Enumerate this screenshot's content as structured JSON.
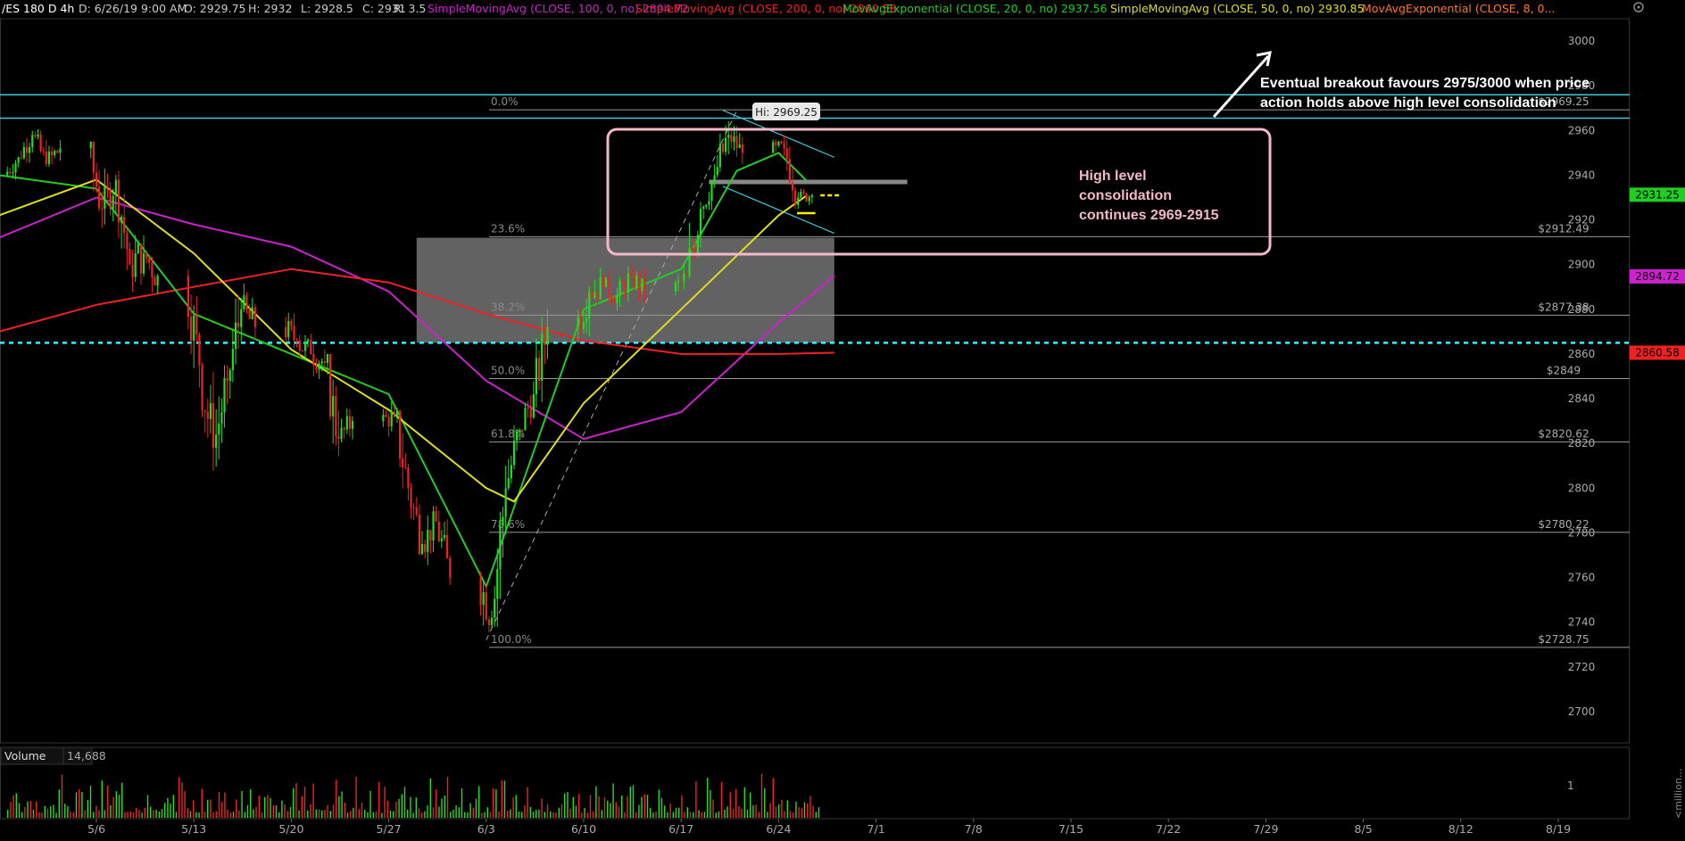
{
  "header": {
    "symbol": "/ES 180 D 4h",
    "bar_date": "D: 6/26/19 9:00 AM",
    "open": "O: 2929.75",
    "high": "H: 2932",
    "low": "L: 2928.5",
    "close": "C: 2931",
    "range": "R: 3.5",
    "studies": [
      {
        "label": "SimpleMovingAvg (CLOSE, 100, 0, no)",
        "value": "2894.72",
        "color": "#cc22cc"
      },
      {
        "label": "SimpleMovingAvg (CLOSE, 200, 0, no)",
        "value": "2860.58",
        "color": "#ee2222"
      },
      {
        "label": "MovAvgExponential (CLOSE, 20, 0, no)",
        "value": "2937.56",
        "color": "#22cc22"
      },
      {
        "label": "SimpleMovingAvg (CLOSE, 50, 0, no)",
        "value": "2930.85",
        "color": "#dddd22"
      },
      {
        "label": "MovAvgExponential (CLOSE, 8, 0...",
        "value": "",
        "color": "#ff7722"
      }
    ]
  },
  "annotations": {
    "breakout": "Eventual breakout favours 2975/3000 when price action holds above high level consolidation",
    "consolidation": "High level consolidation continues 2969-2915",
    "hi_label": "Hi: 2969.25"
  },
  "volume": {
    "label": "Volume",
    "value": "14,688",
    "axis_tick": "1",
    "axis_unit": "<million..."
  },
  "chart_data": {
    "type": "candlestick",
    "title": "/ES 180 D 4h",
    "x_ticks": [
      "5/6",
      "5/13",
      "5/20",
      "5/27",
      "6/3",
      "6/10",
      "6/17",
      "6/24",
      "7/1",
      "7/8",
      "7/15",
      "7/22",
      "7/29",
      "8/5",
      "8/12",
      "8/19"
    ],
    "y_ticks": [
      2700,
      2720,
      2740,
      2760,
      2780,
      2800,
      2820,
      2840,
      2860,
      2880,
      2900,
      2920,
      2940,
      2960,
      2980,
      3000
    ],
    "ylim": [
      2686,
      3010
    ],
    "last_price": 2931.25,
    "price_badges": [
      {
        "value": "2931.25",
        "color": "#22cc22"
      },
      {
        "value": "2894.72",
        "color": "#cc22cc"
      },
      {
        "value": "2860.58",
        "color": "#ee2222"
      }
    ],
    "fibonacci": [
      {
        "level": "0.0%",
        "price": 2969.25,
        "label": "$2969.25"
      },
      {
        "level": "23.6%",
        "price": 2912.49,
        "label": "$2912.49"
      },
      {
        "level": "38.2%",
        "price": 2877.38,
        "label": "$2877.38"
      },
      {
        "level": "50.0%",
        "price": 2849,
        "label": "$2849"
      },
      {
        "level": "61.8%",
        "price": 2820.62,
        "label": "$2820.62"
      },
      {
        "level": "78.6%",
        "price": 2780.22,
        "label": "$2780.22"
      },
      {
        "level": "100.0%",
        "price": 2728.75,
        "label": "$2728.75"
      }
    ],
    "horizontal_lines": [
      2976,
      2965.5
    ],
    "dotted_support": 2865,
    "shaded_zone": {
      "from": "5/29",
      "to": "6/28",
      "low": 2865,
      "high": 2912
    },
    "candles": [
      [
        "4/30",
        2940,
        2952,
        2935,
        2948
      ],
      [
        "5/1",
        2948,
        2962,
        2944,
        2958
      ],
      [
        "5/2",
        2958,
        2962,
        2940,
        2945
      ],
      [
        "5/3",
        2945,
        2958,
        2936,
        2952
      ],
      [
        "5/6",
        2952,
        2955,
        2915,
        2925
      ],
      [
        "5/7",
        2925,
        2948,
        2915,
        2938
      ],
      [
        "5/8",
        2938,
        2942,
        2895,
        2900
      ],
      [
        "5/9",
        2900,
        2918,
        2880,
        2905
      ],
      [
        "5/10",
        2905,
        2915,
        2880,
        2895
      ],
      [
        "5/13",
        2895,
        2898,
        2845,
        2855
      ],
      [
        "5/14",
        2855,
        2862,
        2800,
        2818
      ],
      [
        "5/15",
        2818,
        2855,
        2805,
        2848
      ],
      [
        "5/16",
        2848,
        2895,
        2840,
        2880
      ],
      [
        "5/17",
        2880,
        2892,
        2860,
        2872
      ],
      [
        "5/20",
        2872,
        2880,
        2855,
        2866
      ],
      [
        "5/21",
        2866,
        2878,
        2852,
        2860
      ],
      [
        "5/22",
        2860,
        2868,
        2845,
        2856
      ],
      [
        "5/23",
        2856,
        2860,
        2810,
        2822
      ],
      [
        "5/24",
        2822,
        2838,
        2815,
        2830
      ],
      [
        "5/27",
        2830,
        2840,
        2820,
        2832
      ],
      [
        "5/28",
        2832,
        2836,
        2790,
        2800
      ],
      [
        "5/29",
        2800,
        2808,
        2770,
        2775
      ],
      [
        "5/30",
        2775,
        2792,
        2765,
        2785
      ],
      [
        "5/31",
        2785,
        2790,
        2750,
        2760
      ],
      [
        "6/3",
        2760,
        2768,
        2729,
        2742
      ],
      [
        "6/4",
        2742,
        2810,
        2738,
        2800
      ],
      [
        "6/5",
        2800,
        2835,
        2795,
        2826
      ],
      [
        "6/6",
        2826,
        2848,
        2818,
        2842
      ],
      [
        "6/7",
        2842,
        2880,
        2836,
        2872
      ],
      [
        "6/10",
        2872,
        2900,
        2865,
        2888
      ],
      [
        "6/11",
        2888,
        2906,
        2880,
        2890
      ],
      [
        "6/12",
        2890,
        2898,
        2878,
        2886
      ],
      [
        "6/13",
        2886,
        2902,
        2880,
        2895
      ],
      [
        "6/14",
        2895,
        2900,
        2880,
        2888
      ],
      [
        "6/17",
        2888,
        2902,
        2882,
        2895
      ],
      [
        "6/18",
        2895,
        2935,
        2890,
        2925
      ],
      [
        "6/19",
        2925,
        2945,
        2918,
        2940
      ],
      [
        "6/20",
        2940,
        2969,
        2935,
        2958
      ],
      [
        "6/21",
        2958,
        2966,
        2945,
        2950
      ],
      [
        "6/24",
        2950,
        2962,
        2944,
        2952
      ],
      [
        "6/25",
        2952,
        2956,
        2925,
        2930
      ],
      [
        "6/26",
        2930,
        2934,
        2922,
        2931
      ]
    ],
    "series": [
      {
        "name": "SimpleMovingAvg (CLOSE, 100, 0, no)",
        "color": "#cc22cc",
        "points": [
          [
            "4/29",
            2912
          ],
          [
            "5/6",
            2930
          ],
          [
            "5/13",
            2918
          ],
          [
            "5/20",
            2908
          ],
          [
            "5/27",
            2888
          ],
          [
            "6/3",
            2848
          ],
          [
            "6/10",
            2822
          ],
          [
            "6/17",
            2834
          ],
          [
            "6/24",
            2874
          ],
          [
            "6/28",
            2895
          ]
        ]
      },
      {
        "name": "SimpleMovingAvg (CLOSE, 200, 0, no)",
        "color": "#ee2222",
        "points": [
          [
            "4/29",
            2870
          ],
          [
            "5/6",
            2882
          ],
          [
            "5/13",
            2890
          ],
          [
            "5/20",
            2898
          ],
          [
            "5/27",
            2892
          ],
          [
            "6/3",
            2878
          ],
          [
            "6/10",
            2866
          ],
          [
            "6/17",
            2860
          ],
          [
            "6/24",
            2860
          ],
          [
            "6/28",
            2860.58
          ]
        ]
      },
      {
        "name": "MovAvgExponential (CLOSE, 20, 0, no)",
        "color": "#22cc22",
        "points": [
          [
            "4/29",
            2940
          ],
          [
            "5/6",
            2934
          ],
          [
            "5/13",
            2878
          ],
          [
            "5/20",
            2860
          ],
          [
            "5/27",
            2842
          ],
          [
            "6/3",
            2756
          ],
          [
            "6/10",
            2880
          ],
          [
            "6/17",
            2898
          ],
          [
            "6/21",
            2942
          ],
          [
            "6/24",
            2950
          ],
          [
            "6/26",
            2937.56
          ]
        ]
      },
      {
        "name": "SimpleMovingAvg (CLOSE, 50, 0, no)",
        "color": "#dddd22",
        "points": [
          [
            "4/29",
            2922
          ],
          [
            "5/6",
            2938
          ],
          [
            "5/13",
            2905
          ],
          [
            "5/20",
            2862
          ],
          [
            "5/27",
            2835
          ],
          [
            "6/3",
            2800
          ],
          [
            "6/5",
            2794
          ],
          [
            "6/10",
            2838
          ],
          [
            "6/17",
            2880
          ],
          [
            "6/24",
            2922
          ],
          [
            "6/26",
            2930.85
          ]
        ]
      }
    ],
    "volume_max": 1.6
  }
}
